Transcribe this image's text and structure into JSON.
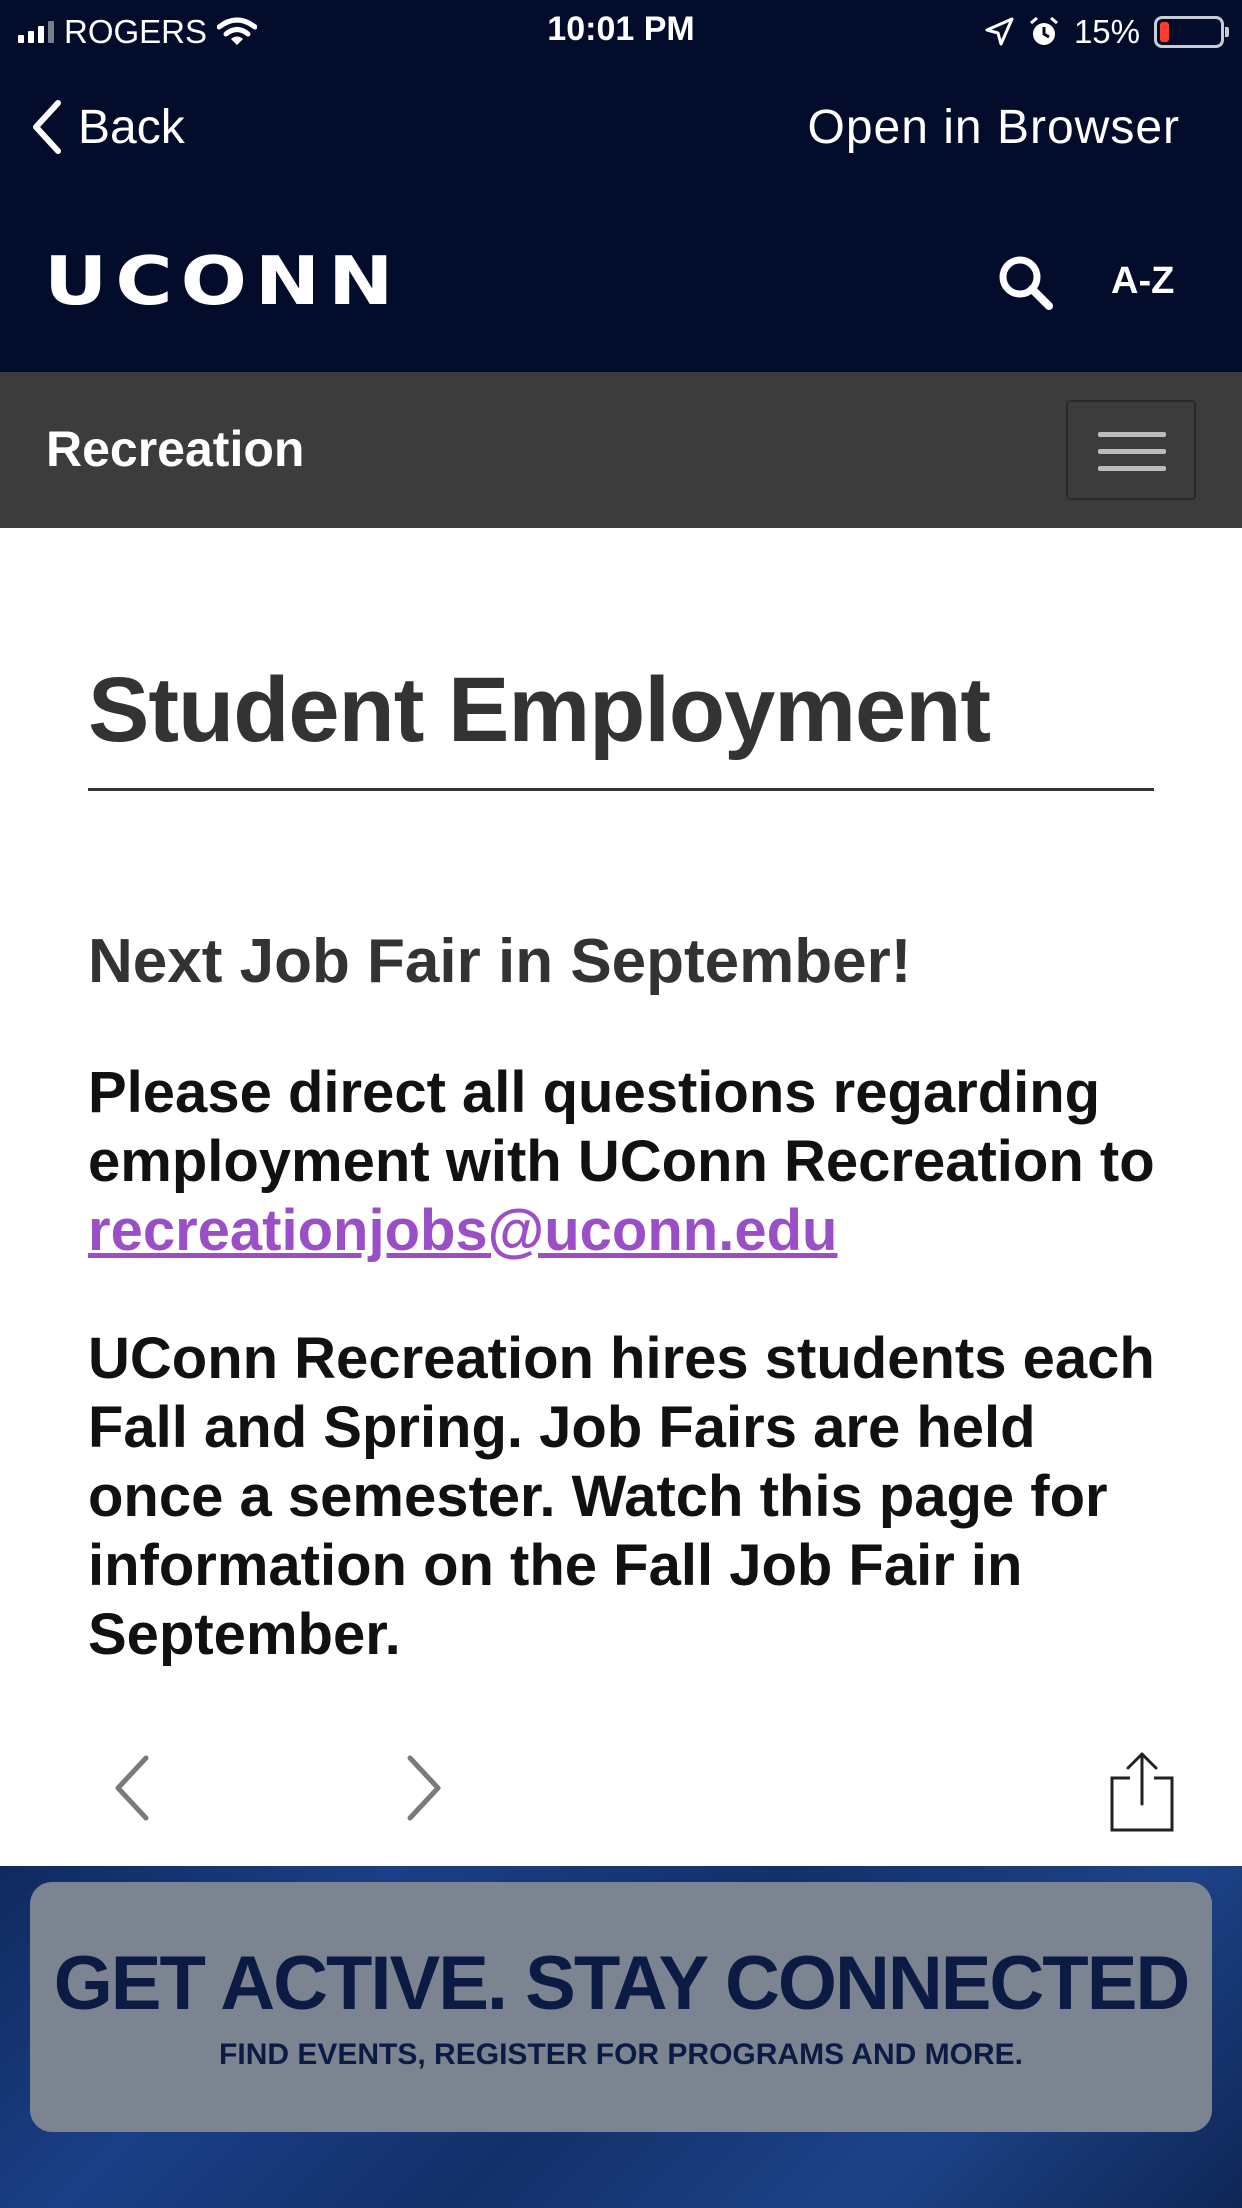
{
  "status_bar": {
    "carrier": "ROGERS",
    "time": "10:01 PM",
    "battery_percent": "15%",
    "battery_level": 0.15,
    "icons": [
      "cellular-signal-icon",
      "wifi-icon",
      "location-arrow-icon",
      "alarm-icon",
      "battery-icon"
    ]
  },
  "nav": {
    "back_label": "Back",
    "open_browser_label": "Open in Browser"
  },
  "header": {
    "logo_text": "UCONN",
    "search_icon": "search-icon",
    "az_label": "A-Z"
  },
  "section_bar": {
    "title": "Recreation",
    "menu_icon": "hamburger-menu-icon"
  },
  "content": {
    "page_title": "Student Employment",
    "subheading": "Next Job Fair in September!",
    "para1_text": "Please direct all questions regarding employment with UConn Recreation to ",
    "email": "recreationjobs@uconn.edu",
    "para2_text": "UConn Recreation hires students each Fall and Spring. Job Fairs are held once a semester.  Watch this page for information on the Fall Job Fair in September."
  },
  "toolbar": {
    "icons": [
      "chevron-left-icon",
      "chevron-right-icon",
      "share-icon"
    ]
  },
  "banner": {
    "headline": "GET ACTIVE.  STAY CONNECTED",
    "subline": "FIND EVENTS, REGISTER FOR PROGRAMS AND MORE."
  },
  "colors": {
    "header_bg": "#030c2b",
    "section_bar_bg": "#3c3c3c",
    "link": "#9b4fc7",
    "battery_low": "#ff3b30"
  }
}
